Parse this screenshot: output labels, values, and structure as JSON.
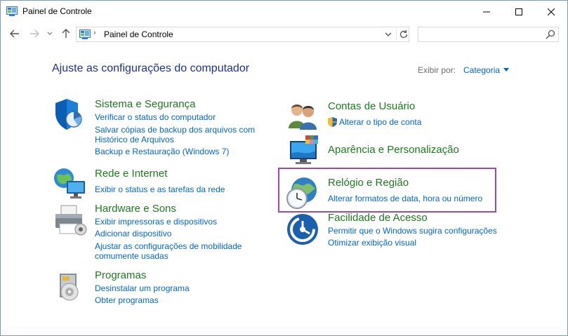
{
  "window": {
    "title": "Painel de Controle",
    "colors": {
      "heading": "#1e3287",
      "category": "#1e7a1e",
      "link": "#0066cc",
      "highlight": "#9b4aa8"
    }
  },
  "address_bar": {
    "path": "Painel de Controle",
    "separator": "›",
    "search_placeholder": ""
  },
  "main": {
    "heading": "Ajuste as configurações do computador",
    "view_by_label": "Exibir por:",
    "view_by_value": "Categoria"
  },
  "categories": {
    "sistema": {
      "title": "Sistema e Segurança",
      "links": [
        "Verificar o status do computador",
        "Salvar cópias de backup dos arquivos com",
        "Histórico de Arquivos",
        "Backup e Restauração (Windows 7)"
      ]
    },
    "rede": {
      "title": "Rede e Internet",
      "links": [
        "Exibir o status e as tarefas da rede"
      ]
    },
    "hardware": {
      "title": "Hardware e Sons",
      "links": [
        "Exibir impressoras e dispositivos",
        "Adicionar dispositivo",
        "Ajustar as configurações de mobilidade",
        "comumente usadas"
      ]
    },
    "programas": {
      "title": "Programas",
      "links": [
        "Desinstalar um programa",
        "Obter programas"
      ]
    },
    "contas": {
      "title": "Contas de Usuário",
      "links": [
        "Alterar o tipo de conta"
      ]
    },
    "aparencia": {
      "title": "Aparência e Personalização",
      "links": []
    },
    "relogio": {
      "title": "Relógio e Região",
      "links": [
        "Alterar formatos de data, hora ou número"
      ]
    },
    "facilidade": {
      "title": "Facilidade de Acesso",
      "links": [
        "Permitir que o Windows sugira configurações",
        "Otimizar exibição visual"
      ]
    }
  }
}
